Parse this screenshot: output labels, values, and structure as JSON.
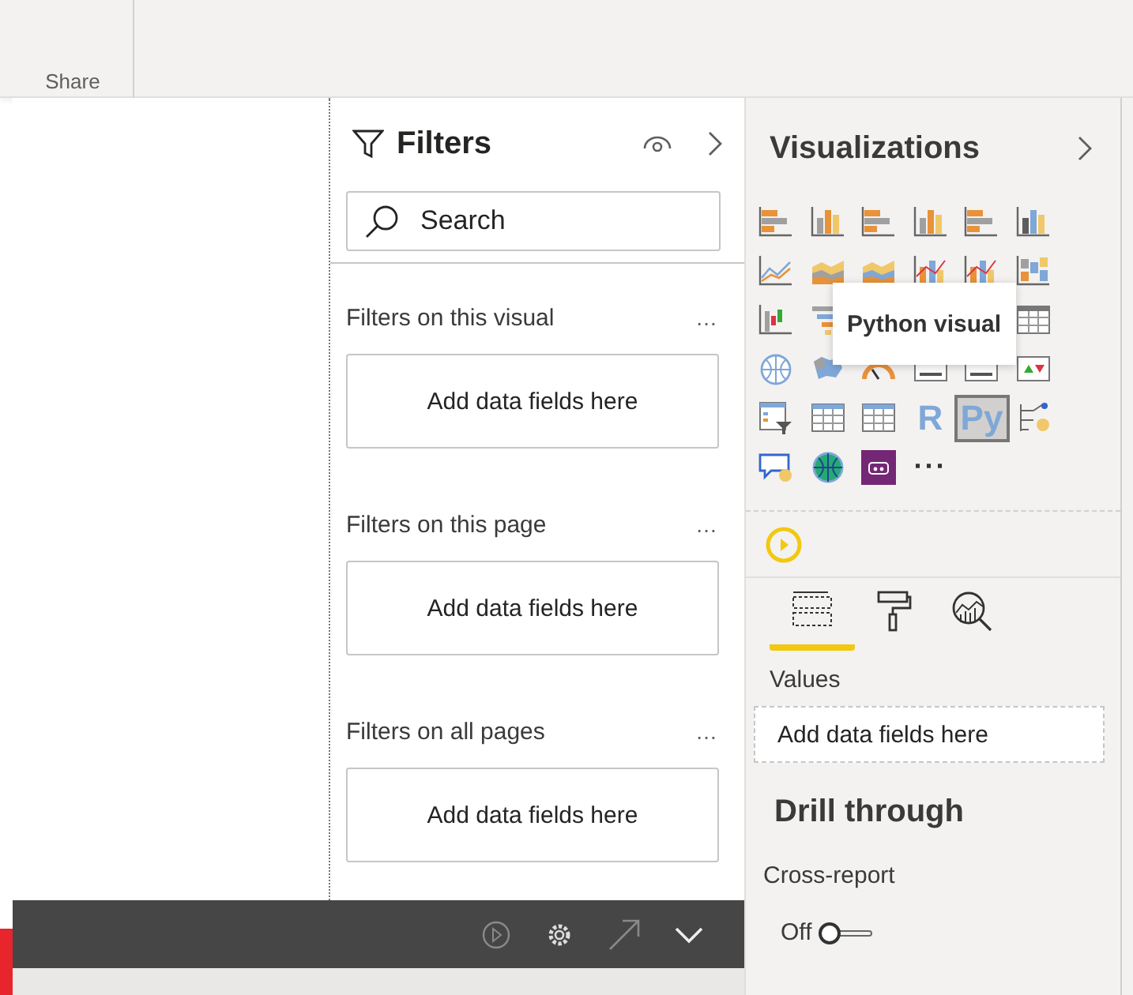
{
  "ribbon": {
    "group_label": "Share"
  },
  "filters": {
    "title": "Filters",
    "search": {
      "placeholder": "Search"
    },
    "sections": [
      {
        "title": "Filters on this visual",
        "more": "…",
        "dropzone": "Add data fields here"
      },
      {
        "title": "Filters on this page",
        "more": "…",
        "dropzone": "Add data fields here"
      },
      {
        "title": "Filters on all pages",
        "more": "…",
        "dropzone": "Add data fields here"
      }
    ]
  },
  "visualizations": {
    "title": "Visualizations",
    "rows": [
      [
        {
          "kind": "hbar"
        },
        {
          "kind": "vbar"
        },
        {
          "kind": "hbar"
        },
        {
          "kind": "vbar"
        },
        {
          "kind": "hbar"
        },
        {
          "kind": "vbar"
        }
      ],
      [
        {
          "kind": "line"
        },
        {
          "kind": "area"
        },
        {
          "kind": "area"
        },
        {
          "kind": "combo"
        },
        {
          "kind": "combo"
        },
        {
          "kind": "blocks"
        }
      ],
      [
        {
          "kind": "waterfall"
        },
        {
          "kind": "funnel"
        },
        {
          "kind": "grid"
        }
      ],
      [
        {
          "kind": "globe"
        },
        {
          "kind": "map"
        },
        {
          "kind": "gauge"
        },
        {
          "kind": "card"
        },
        {
          "kind": "card"
        },
        {
          "kind": "kpi"
        }
      ],
      [
        {
          "kind": "slicer"
        },
        {
          "kind": "grid"
        },
        {
          "kind": "grid"
        },
        {
          "kind": "letter",
          "text": "R",
          "selected": false
        },
        {
          "kind": "letter",
          "text": "Py",
          "selected": true
        },
        {
          "kind": "tree"
        }
      ],
      [
        {
          "kind": "bubble"
        },
        {
          "kind": "globe"
        },
        {
          "kind": "app"
        },
        {
          "kind": "more",
          "text": "···"
        }
      ]
    ],
    "tooltip": "Python visual",
    "tabs": [
      {
        "kind": "fields",
        "selected": true
      },
      {
        "kind": "format",
        "selected": false
      },
      {
        "kind": "analytics",
        "selected": false
      }
    ],
    "values_label": "Values",
    "values_dropzone": "Add data fields here",
    "drill_title": "Drill through",
    "cross_report_label": "Cross-report",
    "toggle": {
      "label": "Off",
      "on": false
    }
  }
}
